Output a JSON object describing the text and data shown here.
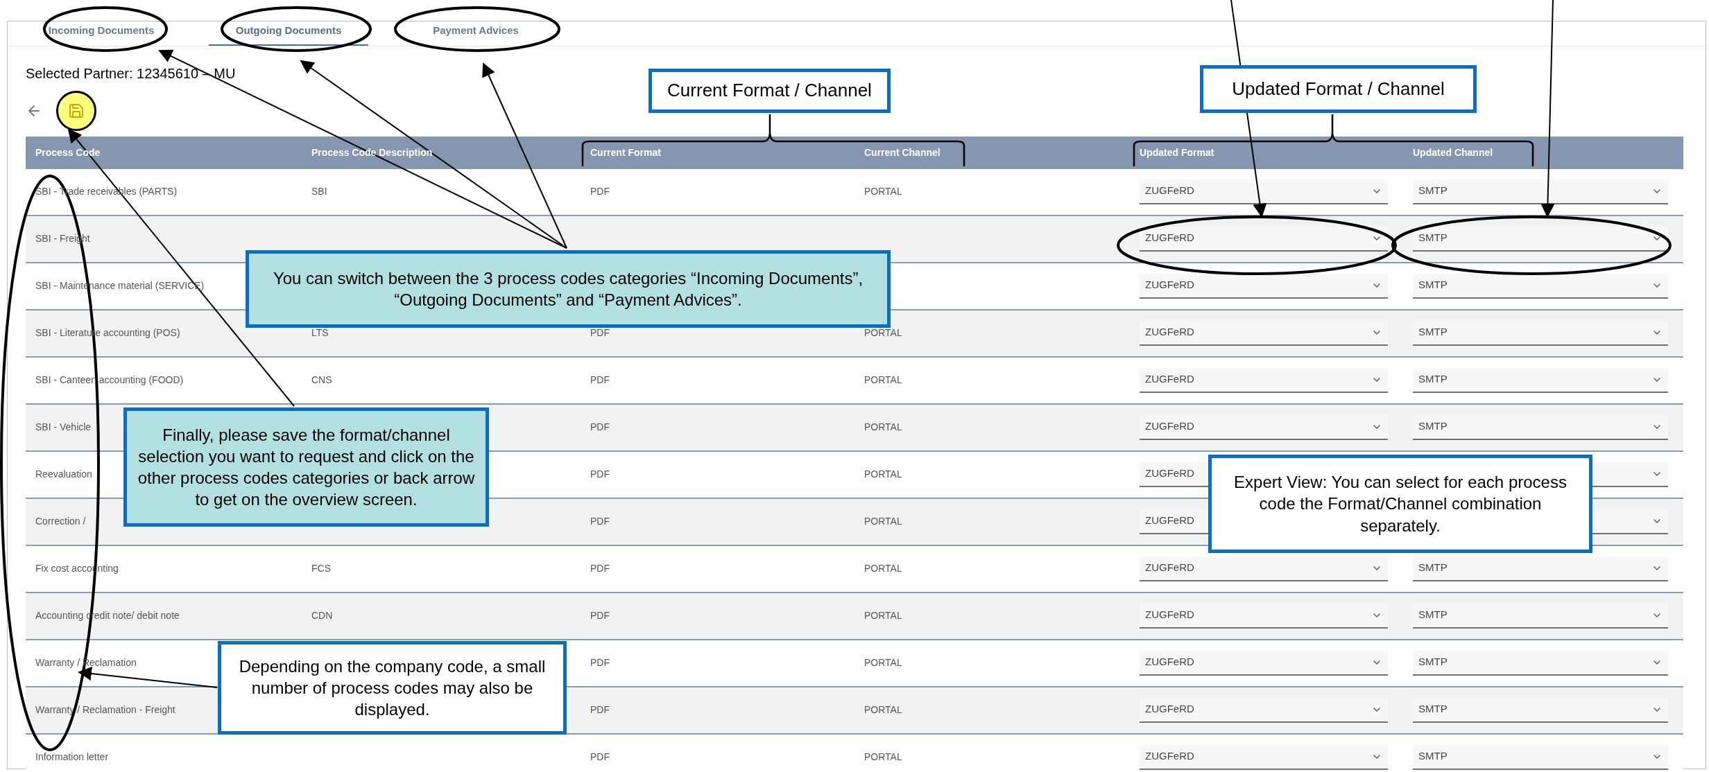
{
  "tabs": [
    {
      "label": "Incoming Documents",
      "selected": false
    },
    {
      "label": "Outgoing Documents",
      "selected": true
    },
    {
      "label": "Payment Advices",
      "selected": false
    }
  ],
  "partner_label": "Selected Partner: 12345610 – MU",
  "table": {
    "columns": [
      "Process Code",
      "Process Code Description",
      "Current Format",
      "Current Channel",
      "Updated Format",
      "Updated Channel"
    ],
    "rows": [
      {
        "process_code": "SBI - Trade receivables (PARTS)",
        "description": "SBI",
        "current_format": "PDF",
        "current_channel": "PORTAL",
        "updated_format": "ZUGFeRD",
        "updated_channel": "SMTP"
      },
      {
        "process_code": "SBI - Freight",
        "updated_format": "ZUGFeRD",
        "updated_channel": "SMTP"
      },
      {
        "process_code": "SBI - Maintenance material (SERVICE)",
        "updated_format": "ZUGFeRD",
        "updated_channel": "SMTP"
      },
      {
        "process_code": "SBI - Literature accounting (POS)",
        "description": "LTS",
        "current_format": "PDF",
        "current_channel": "PORTAL",
        "updated_format": "ZUGFeRD",
        "updated_channel": "SMTP"
      },
      {
        "process_code": "SBI - Canteen accounting (FOOD)",
        "description": "CNS",
        "current_format": "PDF",
        "current_channel": "PORTAL",
        "updated_format": "ZUGFeRD",
        "updated_channel": "SMTP"
      },
      {
        "process_code": "SBI - Vehicle",
        "current_format": "PDF",
        "current_channel": "PORTAL",
        "updated_format": "ZUGFeRD",
        "updated_channel": "SMTP"
      },
      {
        "process_code": "Reevaluation",
        "current_format": "PDF",
        "current_channel": "PORTAL",
        "updated_format": "ZUGFeRD"
      },
      {
        "process_code": "Correction /",
        "current_format": "PDF",
        "current_channel": "PORTAL",
        "updated_format": "ZUGFeRD"
      },
      {
        "process_code": "Fix cost accounting",
        "description": "FCS",
        "current_format": "PDF",
        "current_channel": "PORTAL",
        "updated_format": "ZUGFeRD",
        "updated_channel": "SMTP"
      },
      {
        "process_code": "Accounting credit note/ debit note",
        "description": "CDN",
        "current_format": "PDF",
        "current_channel": "PORTAL",
        "updated_format": "ZUGFeRD",
        "updated_channel": "SMTP"
      },
      {
        "process_code": "Warranty / Reclamation",
        "current_format": "PDF",
        "current_channel": "PORTAL",
        "updated_format": "ZUGFeRD",
        "updated_channel": "SMTP"
      },
      {
        "process_code": "Warranty / Reclamation - Freight",
        "current_format": "PDF",
        "current_channel": "PORTAL",
        "updated_format": "ZUGFeRD",
        "updated_channel": "SMTP"
      },
      {
        "process_code": "Information letter",
        "current_format": "PDF",
        "current_channel": "PORTAL",
        "updated_format": "ZUGFeRD",
        "updated_channel": "SMTP"
      }
    ]
  },
  "callouts": [
    {
      "kind": "plain",
      "text": "Current Format / Channel"
    },
    {
      "kind": "plain",
      "text": "Updated Format / Channel"
    },
    {
      "kind": "highlight",
      "text": "You can switch between the 3 process codes categories “Incoming Documents”, “Outgoing Documents” and “Payment Advices”."
    },
    {
      "kind": "highlight",
      "text": "Finally, please save the format/channel selection you want to request and click on the other process codes categories or back arrow to get on the overview screen."
    },
    {
      "kind": "plain",
      "text": "Expert View: You can select for each process code the Format/Channel combination separately."
    },
    {
      "kind": "plain",
      "text": "Depending on the company code, a small number of process codes may also be displayed."
    }
  ]
}
